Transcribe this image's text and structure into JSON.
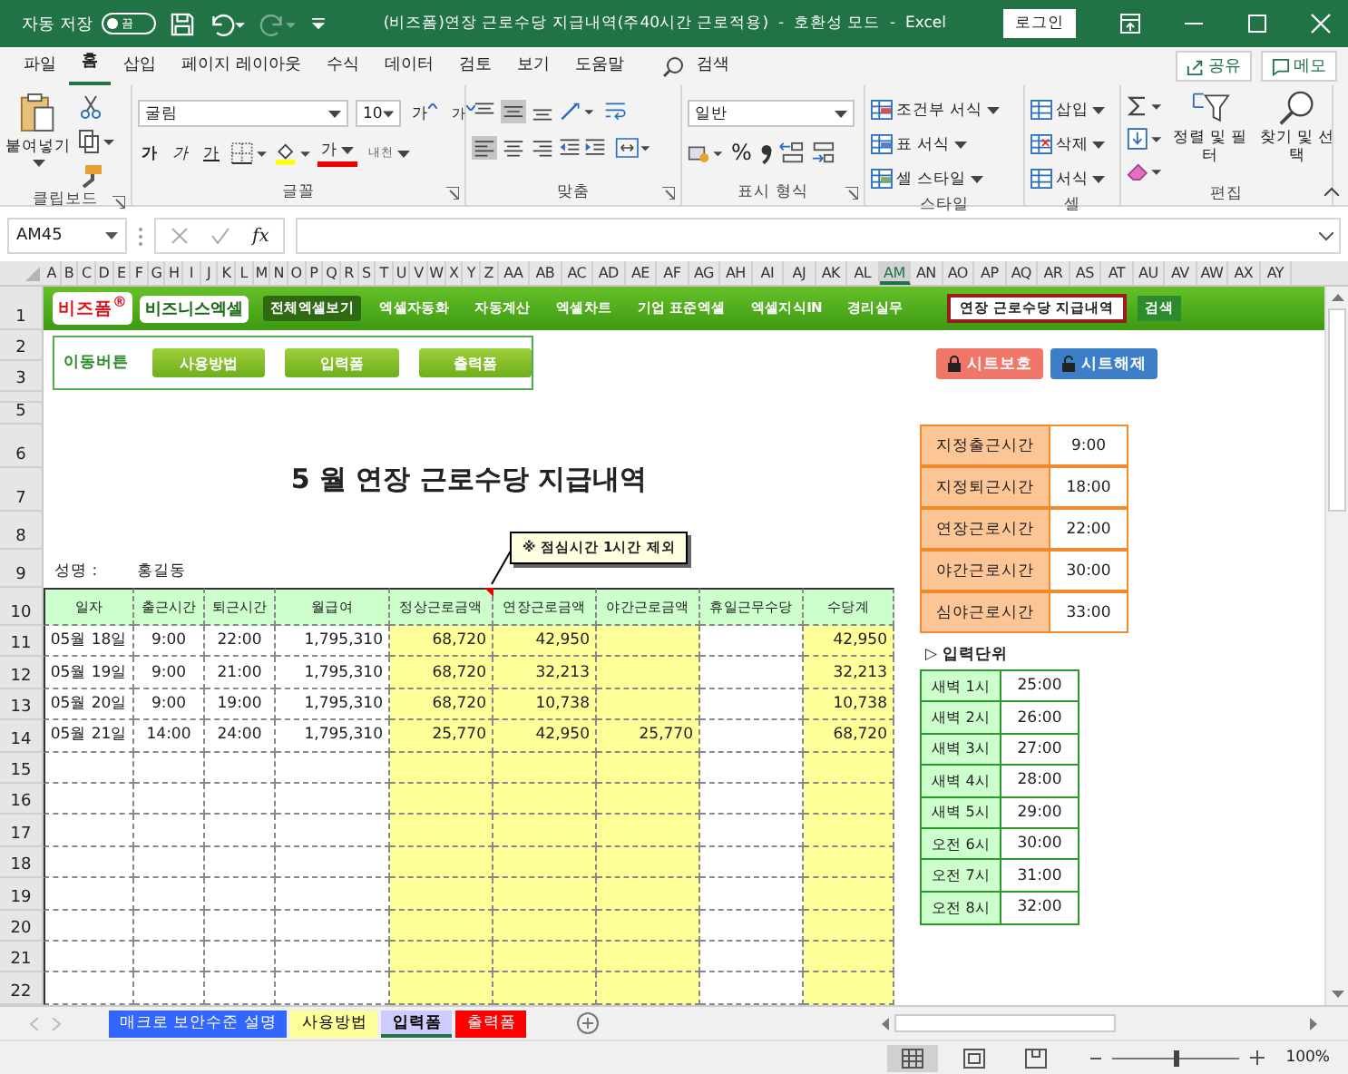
{
  "title_bar": {
    "autosave_label": "자동 저장",
    "autosave_on": false,
    "autosave_state": "끔",
    "redo_disabled": true,
    "title": "(비즈폼)연장 근로수당 지급내역(주40시간 근로적용)  -  호환성 모드  -  Excel",
    "login": "로그인"
  },
  "ribbon": {
    "tabs": [
      {
        "label": "파일",
        "selected": false
      },
      {
        "label": "홈",
        "selected": true
      },
      {
        "label": "삽입",
        "selected": false
      },
      {
        "label": "페이지 레이아웃",
        "selected": false
      },
      {
        "label": "수식",
        "selected": false
      },
      {
        "label": "데이터",
        "selected": false
      },
      {
        "label": "검토",
        "selected": false
      },
      {
        "label": "보기",
        "selected": false
      },
      {
        "label": "도움말",
        "selected": false
      }
    ],
    "search": "검색",
    "share": "공유",
    "memo": "메모",
    "clipboard": {
      "label": "클립보드",
      "paste": "붙여넣기"
    },
    "font": {
      "label": "글꼴",
      "name": "굴림",
      "size": "10",
      "grow": "가",
      "shrink": "가",
      "bold": "가",
      "italic": "가",
      "underline": "가",
      "font_color_label": "가",
      "phonetic": "내천"
    },
    "alignment": {
      "label": "맞춤",
      "vertical": [
        {
          "selected": false
        },
        {
          "selected": true
        },
        {
          "selected": false
        }
      ],
      "horizontal": [
        {
          "selected": true
        },
        {
          "selected": false
        },
        {
          "selected": false
        }
      ]
    },
    "number": {
      "label": "표시 형식",
      "format": "일반",
      "percent": "%"
    },
    "styles": {
      "label": "스타일",
      "items": [
        "조건부 서식",
        "표 서식",
        "셀 스타일"
      ]
    },
    "cells": {
      "label": "셀",
      "items": [
        "삽입",
        "삭제",
        "서식"
      ]
    },
    "editing": {
      "label": "편집",
      "sort": "정렬 및 필터",
      "find": "찾기 및 선택"
    }
  },
  "formula_bar": {
    "name_box": "AM45",
    "fx": "fx"
  },
  "column_headers": [
    {
      "label": "A",
      "selected": false
    },
    {
      "label": "B",
      "selected": false
    },
    {
      "label": "C",
      "selected": false
    },
    {
      "label": "D",
      "selected": false
    },
    {
      "label": "E",
      "selected": false
    },
    {
      "label": "F",
      "selected": false
    },
    {
      "label": "G",
      "selected": false
    },
    {
      "label": "H",
      "selected": false
    },
    {
      "label": "I",
      "selected": false
    },
    {
      "label": "J",
      "selected": false
    },
    {
      "label": "K",
      "selected": false
    },
    {
      "label": "L",
      "selected": false
    },
    {
      "label": "M",
      "selected": false
    },
    {
      "label": "N",
      "selected": false
    },
    {
      "label": "O",
      "selected": false
    },
    {
      "label": "P",
      "selected": false
    },
    {
      "label": "Q",
      "selected": false
    },
    {
      "label": "R",
      "selected": false
    },
    {
      "label": "S",
      "selected": false
    },
    {
      "label": "T",
      "selected": false
    },
    {
      "label": "U",
      "selected": false
    },
    {
      "label": "V",
      "selected": false
    },
    {
      "label": "W",
      "selected": false
    },
    {
      "label": "X",
      "selected": false
    },
    {
      "label": "Y",
      "selected": false
    },
    {
      "label": "Z",
      "selected": false
    },
    {
      "label": "AA",
      "selected": false
    },
    {
      "label": "AB",
      "selected": false
    },
    {
      "label": "AC",
      "selected": false
    },
    {
      "label": "AD",
      "selected": false
    },
    {
      "label": "AE",
      "selected": false
    },
    {
      "label": "AF",
      "selected": false
    },
    {
      "label": "AG",
      "selected": false
    },
    {
      "label": "AH",
      "selected": false
    },
    {
      "label": "AI",
      "selected": false
    },
    {
      "label": "AJ",
      "selected": false
    },
    {
      "label": "AK",
      "selected": false
    },
    {
      "label": "AL",
      "selected": false
    },
    {
      "label": "AM",
      "selected": true
    },
    {
      "label": "AN",
      "selected": false
    },
    {
      "label": "AO",
      "selected": false
    },
    {
      "label": "AP",
      "selected": false
    },
    {
      "label": "AQ",
      "selected": false
    },
    {
      "label": "AR",
      "selected": false
    },
    {
      "label": "AS",
      "selected": false
    },
    {
      "label": "AT",
      "selected": false
    },
    {
      "label": "AU",
      "selected": false
    },
    {
      "label": "AV",
      "selected": false
    },
    {
      "label": "AW",
      "selected": false
    },
    {
      "label": "AX",
      "selected": false
    },
    {
      "label": "AY",
      "selected": false
    }
  ],
  "row_numbers": [
    "1",
    "2",
    "3",
    "5",
    "6",
    "7",
    "8",
    "9",
    "10",
    "11",
    "12",
    "13",
    "14",
    "15",
    "16",
    "17",
    "18",
    "19",
    "20",
    "21",
    "22"
  ],
  "banner": {
    "logo": "비즈폼$^{®}$",
    "logo2": "비즈니스엑셀",
    "menu": [
      {
        "label": "전체엑셀보기",
        "selected": true
      },
      {
        "label": "엑셀자동화",
        "selected": false
      },
      {
        "label": "자동계산",
        "selected": false
      },
      {
        "label": "엑셀차트",
        "selected": false
      },
      {
        "label": "기업 표준엑셀",
        "selected": false
      },
      {
        "label": "엑셀지식IN",
        "selected": false
      },
      {
        "label": "경리실무",
        "selected": false
      }
    ],
    "search_value": "연장 근로수당 지급내역",
    "search_button": "검색"
  },
  "nav": {
    "label": "이동버튼",
    "buttons": [
      "사용방법",
      "입력폼",
      "출력폼"
    ],
    "protect": "시트보호",
    "unprotect": "시트해제"
  },
  "sheet": {
    "title": "5 월 연장 근로수당 지급내역",
    "name_label": "성명 :",
    "name": "홍길동",
    "note": "※ 점심시간 1시간 제외",
    "columns": [
      {
        "label": "일자",
        "highlighted": false
      },
      {
        "label": "출근시간",
        "highlighted": false
      },
      {
        "label": "퇴근시간",
        "highlighted": false
      },
      {
        "label": "월급여",
        "highlighted": false
      },
      {
        "label": "정상근로금액",
        "highlighted": true
      },
      {
        "label": "연장근로금액",
        "highlighted": true
      },
      {
        "label": "야간근로금액",
        "highlighted": true
      },
      {
        "label": "휴일근무수당",
        "highlighted": false
      },
      {
        "label": "수당계",
        "highlighted": true
      }
    ],
    "rows": [
      [
        "05월 18일",
        "9:00",
        "22:00",
        "1,795,310",
        "68,720",
        "42,950",
        null,
        null,
        "42,950"
      ],
      [
        "05월 19일",
        "9:00",
        "21:00",
        "1,795,310",
        "68,720",
        "32,213",
        null,
        null,
        "32,213"
      ],
      [
        "05월 20일",
        "9:00",
        "19:00",
        "1,795,310",
        "68,720",
        "10,738",
        null,
        null,
        "10,738"
      ],
      [
        "05월 21일",
        "14:00",
        "24:00",
        "1,795,310",
        "25,770",
        "42,950",
        "25,770",
        null,
        "68,720"
      ],
      [
        null,
        null,
        null,
        null,
        null,
        null,
        null,
        null,
        null
      ],
      [
        null,
        null,
        null,
        null,
        null,
        null,
        null,
        null,
        null
      ],
      [
        null,
        null,
        null,
        null,
        null,
        null,
        null,
        null,
        null
      ],
      [
        null,
        null,
        null,
        null,
        null,
        null,
        null,
        null,
        null
      ],
      [
        null,
        null,
        null,
        null,
        null,
        null,
        null,
        null,
        null
      ],
      [
        null,
        null,
        null,
        null,
        null,
        null,
        null,
        null,
        null
      ],
      [
        null,
        null,
        null,
        null,
        null,
        null,
        null,
        null,
        null
      ],
      [
        null,
        null,
        null,
        null,
        null,
        null,
        null,
        null,
        null
      ]
    ],
    "settings": [
      {
        "label": "지정출근시간",
        "value": "9:00"
      },
      {
        "label": "지정퇴근시간",
        "value": "18:00"
      },
      {
        "label": "연장근로시간",
        "value": "22:00"
      },
      {
        "label": "야간근로시간",
        "value": "30:00"
      },
      {
        "label": "심야근로시간",
        "value": "33:00"
      }
    ],
    "unit_label": "▷ 입력단위",
    "units": [
      {
        "label": "새벽 1시",
        "value": "25:00"
      },
      {
        "label": "새벽 2시",
        "value": "26:00"
      },
      {
        "label": "새벽 3시",
        "value": "27:00"
      },
      {
        "label": "새벽 4시",
        "value": "28:00"
      },
      {
        "label": "새벽 5시",
        "value": "29:00"
      },
      {
        "label": "오전 6시",
        "value": "30:00"
      },
      {
        "label": "오전 7시",
        "value": "31:00"
      },
      {
        "label": "오전 8시",
        "value": "32:00"
      }
    ]
  },
  "sheet_tabs": [
    {
      "label": "매크로 보안수준 설명",
      "color": "#3366ff",
      "selected": false
    },
    {
      "label": "사용방법",
      "color": "#ffff99",
      "selected": false
    },
    {
      "label": "입력폼",
      "color": "#ccccff",
      "selected": true
    },
    {
      "label": "출력폼",
      "color": "#ff0000",
      "selected": false
    }
  ],
  "status_bar": {
    "views": [
      {
        "selected": true
      },
      {
        "selected": false
      },
      {
        "selected": false
      }
    ],
    "zoom": {
      "level": 0.5,
      "reading": "100%"
    }
  }
}
